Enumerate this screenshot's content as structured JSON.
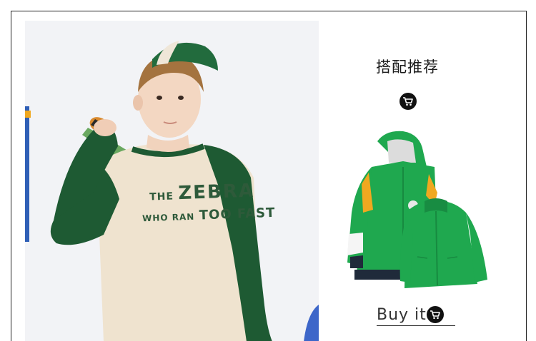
{
  "recommendation": {
    "title": "搭配推荐",
    "cart_icon": "shopping-cart-icon",
    "buy_label": "Buy it"
  },
  "model_photo": {
    "shirt_print_line1_small": "THE",
    "shirt_print_line1_big": "ZEBRA",
    "shirt_print_line2_small": "WHO RAN",
    "shirt_print_line2_big": "TOO FAST"
  },
  "product": {
    "items": [
      "jacket-shell",
      "fleece-inner"
    ],
    "colors": {
      "primary": "#1fa84f",
      "accent": "#f0a820",
      "dark": "#1f2a3a"
    }
  },
  "colors": {
    "sleeve": "#1e5a33",
    "body": "#efe3cf",
    "cap": "#226b3d",
    "hair": "#a4733f",
    "badge": "#111111"
  }
}
